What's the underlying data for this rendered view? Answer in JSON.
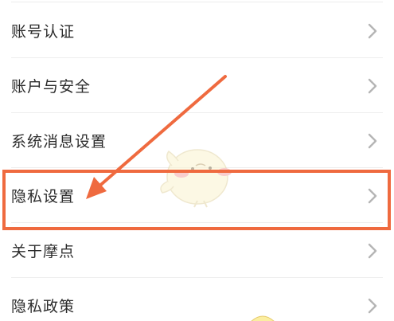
{
  "settings": {
    "items": [
      {
        "label": "账号认证"
      },
      {
        "label": "账户与安全"
      },
      {
        "label": "系统消息设置"
      },
      {
        "label": "隐私设置"
      },
      {
        "label": "关于摩点"
      },
      {
        "label": "隐私政策"
      }
    ]
  },
  "annotation": {
    "highlighted_item": "隐私设置",
    "color": "#ef6a3f"
  },
  "icons": {
    "row_chevron": "chevron-right-icon",
    "watermark": "chick-mascot-icon"
  },
  "colors": {
    "background": "#ffffff",
    "text": "#2b2b2b",
    "chevron": "#b5b5b5",
    "divider": "#ededed",
    "annotation": "#ef6a3f"
  }
}
